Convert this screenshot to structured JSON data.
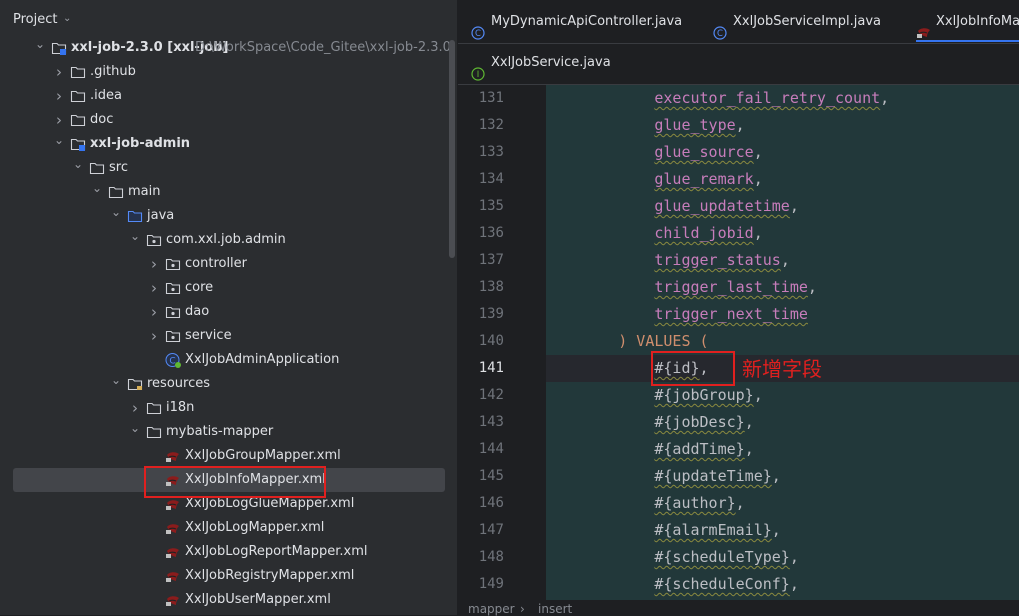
{
  "project_panel": {
    "title": "Project",
    "tree": [
      {
        "label": "xxl-job-2.3.0 [xxl-job]",
        "hint": "D:\\WorkSpace\\Code_Gitee\\xxl-job-2.3.0",
        "icon": "module-folder-icon",
        "expanded": true,
        "depth": 0
      },
      {
        "label": ".github",
        "icon": "folder-icon",
        "expanded": false,
        "depth": 1
      },
      {
        "label": ".idea",
        "icon": "folder-icon",
        "expanded": false,
        "depth": 1
      },
      {
        "label": "doc",
        "icon": "folder-icon",
        "expanded": false,
        "depth": 1
      },
      {
        "label": "xxl-job-admin",
        "icon": "module-folder-icon",
        "expanded": true,
        "depth": 1
      },
      {
        "label": "src",
        "icon": "folder-icon",
        "expanded": true,
        "depth": 2
      },
      {
        "label": "main",
        "icon": "folder-icon",
        "expanded": true,
        "depth": 3
      },
      {
        "label": "java",
        "icon": "source-folder-icon",
        "expanded": true,
        "depth": 4
      },
      {
        "label": "com.xxl.job.admin",
        "icon": "package-icon",
        "expanded": true,
        "depth": 5
      },
      {
        "label": "controller",
        "icon": "package-icon",
        "expanded": false,
        "depth": 6
      },
      {
        "label": "core",
        "icon": "package-icon",
        "expanded": false,
        "depth": 6
      },
      {
        "label": "dao",
        "icon": "package-icon",
        "expanded": false,
        "depth": 6
      },
      {
        "label": "service",
        "icon": "package-icon",
        "expanded": false,
        "depth": 6
      },
      {
        "label": "XxlJobAdminApplication",
        "icon": "spring-class-icon",
        "depth": 6
      },
      {
        "label": "resources",
        "icon": "resources-folder-icon",
        "expanded": true,
        "depth": 4
      },
      {
        "label": "i18n",
        "icon": "folder-icon",
        "expanded": false,
        "depth": 5
      },
      {
        "label": "mybatis-mapper",
        "icon": "folder-icon",
        "expanded": true,
        "depth": 5
      },
      {
        "label": "XxlJobGroupMapper.xml",
        "icon": "mybatis-xml-icon",
        "depth": 6
      },
      {
        "label": "XxlJobInfoMapper.xml",
        "icon": "mybatis-xml-icon",
        "depth": 6,
        "selected": true
      },
      {
        "label": "XxlJobLogGlueMapper.xml",
        "icon": "mybatis-xml-icon",
        "depth": 6
      },
      {
        "label": "XxlJobLogMapper.xml",
        "icon": "mybatis-xml-icon",
        "depth": 6
      },
      {
        "label": "XxlJobLogReportMapper.xml",
        "icon": "mybatis-xml-icon",
        "depth": 6
      },
      {
        "label": "XxlJobRegistryMapper.xml",
        "icon": "mybatis-xml-icon",
        "depth": 6
      },
      {
        "label": "XxlJobUserMapper.xml",
        "icon": "mybatis-xml-icon",
        "depth": 6
      }
    ]
  },
  "editor": {
    "tabs_row1": [
      {
        "label": "MyDynamicApiController.java",
        "icon": "java-class-icon"
      },
      {
        "label": "XxlJobServiceImpl.java",
        "icon": "java-class-icon"
      },
      {
        "label": "XxlJobInfoMap",
        "icon": "mybatis-xml-icon",
        "active": true
      }
    ],
    "tabs_row2": [
      {
        "label": "XxlJobService.java",
        "icon": "java-interface-icon"
      }
    ],
    "current_line": 141,
    "lines": [
      {
        "no": "131",
        "indent": "            ",
        "text": "executor_fail_retry_count",
        "suffix": ","
      },
      {
        "no": "132",
        "indent": "            ",
        "text": "glue_type",
        "suffix": ","
      },
      {
        "no": "133",
        "indent": "            ",
        "text": "glue_source",
        "suffix": ","
      },
      {
        "no": "134",
        "indent": "            ",
        "text": "glue_remark",
        "suffix": ","
      },
      {
        "no": "135",
        "indent": "            ",
        "text": "glue_updatetime",
        "suffix": ","
      },
      {
        "no": "136",
        "indent": "            ",
        "text": "child_jobid",
        "suffix": ","
      },
      {
        "no": "137",
        "indent": "            ",
        "text": "trigger_status",
        "suffix": ","
      },
      {
        "no": "138",
        "indent": "            ",
        "text": "trigger_last_time",
        "suffix": ","
      },
      {
        "no": "139",
        "indent": "            ",
        "text": "trigger_next_time",
        "suffix": ""
      },
      {
        "no": "140",
        "indent": "        ",
        "text": ") VALUES (",
        "suffix": "",
        "kind": "keyword"
      },
      {
        "no": "141",
        "indent": "            ",
        "text": "#{id}",
        "suffix": ",",
        "kind": "param"
      },
      {
        "no": "142",
        "indent": "            ",
        "text": "#{jobGroup}",
        "suffix": ",",
        "kind": "param"
      },
      {
        "no": "143",
        "indent": "            ",
        "text": "#{jobDesc}",
        "suffix": ",",
        "kind": "param"
      },
      {
        "no": "144",
        "indent": "            ",
        "text": "#{addTime}",
        "suffix": ",",
        "kind": "param"
      },
      {
        "no": "145",
        "indent": "            ",
        "text": "#{updateTime}",
        "suffix": ",",
        "kind": "param"
      },
      {
        "no": "146",
        "indent": "            ",
        "text": "#{author}",
        "suffix": ",",
        "kind": "param"
      },
      {
        "no": "147",
        "indent": "            ",
        "text": "#{alarmEmail}",
        "suffix": ",",
        "kind": "param"
      },
      {
        "no": "148",
        "indent": "            ",
        "text": "#{scheduleType}",
        "suffix": ",",
        "kind": "param"
      },
      {
        "no": "149",
        "indent": "            ",
        "text": "#{scheduleConf}",
        "suffix": ",",
        "kind": "param"
      }
    ],
    "annotation": "新增字段",
    "breadcrumb": [
      "mapper",
      "insert"
    ]
  },
  "colors": {
    "highlight_box": "#e0201f",
    "field_color": "#c77dbb",
    "keyword_color": "#cf8e6d"
  }
}
